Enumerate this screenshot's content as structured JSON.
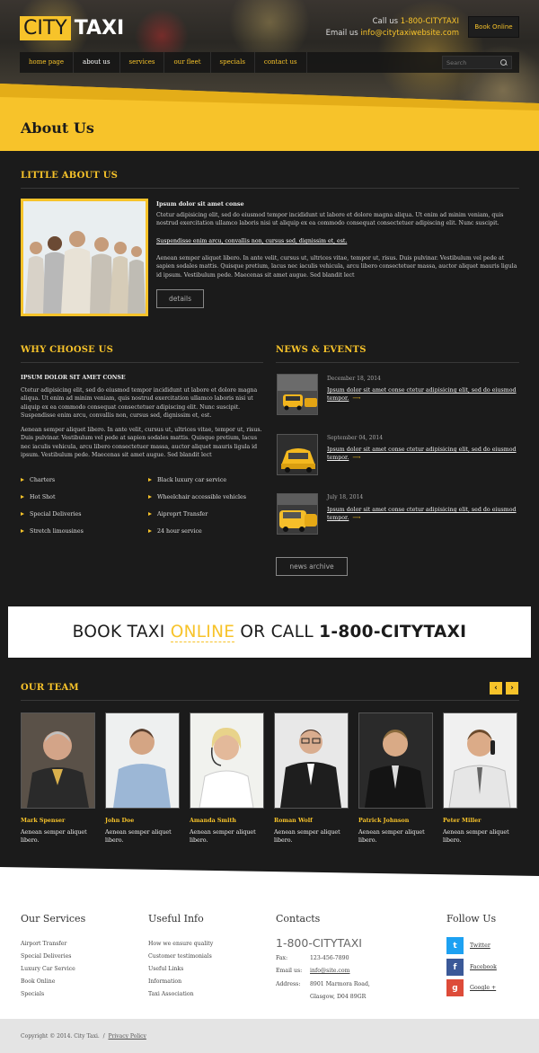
{
  "header": {
    "logo_city": "CITY",
    "logo_taxi": "TAXI",
    "call_label": "Call us",
    "phone": "1-800-CITYTAXI",
    "email_label": "Email us",
    "email": "info@citytaxiwebsite.com",
    "book_online": "Book Online",
    "nav": [
      {
        "label": "home page"
      },
      {
        "label": "about us"
      },
      {
        "label": "services"
      },
      {
        "label": "our fleet"
      },
      {
        "label": "specials"
      },
      {
        "label": "contact us"
      }
    ],
    "search_placeholder": "Search"
  },
  "page_title": "About Us",
  "little_about": {
    "title": "LITTLE ABOUT US",
    "subtitle": "Ipsum dolor sit amet conse",
    "para1": "Ctetur adipisicing elit, sed do eiusmod tempor incididunt ut labore et dolore magna aliqua. Ut enim ad minim veniam, quis nostrud exercitation ullamco laboris nisi ut aliquip ex ea commodo consequat consectetuer adipiscing elit. Nunc suscipit.",
    "link": "Suspendisse enim arcu, convallis non, cursus sed, dignissim et, est.",
    "para2": "Aenean semper aliquet libero. In ante velit, cursus ut, ultrices vitae, tempor ut, risus. Duis pulvinar. Vestibulum vel pede at sapien sodales mattis. Quisque pretium, lacus nec iaculis vehicula, arcu libero consectetuer massa, auctor aliquet mauris ligula id ipsum. Vestibulum pede. Maecenas sit amet augue. Sed blandit lect",
    "details": "details"
  },
  "why_choose": {
    "title": "WHY CHOOSE US",
    "subtitle": "IPSUM DOLOR SIT AMET CONSE",
    "para1": "Ctetur adipisicing elit, sed do eiusmod tempor incididunt ut labore et dolore magna aliqua. Ut enim ad minim veniam, quis nostrud exercitation ullamco laboris nisi ut aliquip ex ea commodo consequat consectetuer adipiscing elit. Nunc suscipit. Suspendisse enim arcu, convallis non, cursus sed, dignissim et, est.",
    "para2": "Aenean semper aliquet libero. In ante velit, cursus ut, ultrices vitae, tempor ut, risus. Duis pulvinar. Vestibulum vel pede at sapien sodales mattis. Quisque pretium, lacus nec iaculis vehicula, arcu libero consectetuer massa, auctor aliquet mauris ligula id ipsum. Vestibulum pede. Maecenas sit amet augue. Sed blandit lect",
    "list_left": [
      "Charters",
      "Hot Shot",
      "Special Deliveries",
      "Stretch limousines"
    ],
    "list_right": [
      "Black luxury car service",
      "Wheelchair accessible vehicles",
      "Aiproprt Transfer",
      "24 hour service"
    ]
  },
  "news": {
    "title": "NEWS & EVENTS",
    "items": [
      {
        "date": "December 18, 2014",
        "text": "Ipsum dolor sit amet conse ctetur adipisicing elit, sed do eiusmod tempor."
      },
      {
        "date": "September 04, 2014",
        "text": "Ipsum dolor sit amet conse ctetur adipisicing elit, sed do eiusmod tempor."
      },
      {
        "date": "July 18, 2014",
        "text": "Ipsum dolor sit amet conse ctetur adipisicing elit, sed do eiusmod tempor."
      }
    ],
    "archive": "news archive"
  },
  "banner": {
    "part1": "BOOK TAXI",
    "part2": "ONLINE",
    "part3": "OR CALL",
    "phone": "1-800-CITYTAXI"
  },
  "team": {
    "title": "OUR TEAM",
    "prev": "‹",
    "next": "›",
    "members": [
      {
        "name": "Mark Spenser",
        "desc": "Aenean semper aliquet libero."
      },
      {
        "name": "John Doe",
        "desc": "Aenean semper aliquet libero."
      },
      {
        "name": "Amanda Smith",
        "desc": "Aenean semper aliquet libero."
      },
      {
        "name": "Roman Wolf",
        "desc": "Aenean semper aliquet libero."
      },
      {
        "name": "Patrick Johnson",
        "desc": "Aenean semper aliquet libero."
      },
      {
        "name": "Peter Miller",
        "desc": "Aenean semper aliquet libero."
      }
    ]
  },
  "footer": {
    "services_title": "Our Services",
    "services": [
      "Airport Transfer",
      "Special Deliveries",
      "Luxury Car Service",
      "Book Online",
      "Specials"
    ],
    "info_title": "Useful Info",
    "info": [
      "How we ensure quality",
      "Customer testimonials",
      "Useful Links",
      "Information",
      "Taxi Association"
    ],
    "contacts_title": "Contacts",
    "phone": "1-800-CITYTAXI",
    "fax_label": "Fax:",
    "fax": "123-456-7890",
    "email_label": "Email us:",
    "email": "info@site.com",
    "address_label": "Address:",
    "address1": "8901 Marmora Road,",
    "address2": "Glasgow, D04 89GR",
    "follow_title": "Follow Us",
    "social": [
      {
        "icon": "t",
        "label": "Twitter",
        "color": "#1da1f2"
      },
      {
        "icon": "f",
        "label": "Facebook",
        "color": "#3b5998"
      },
      {
        "icon": "g",
        "label": "Google +",
        "color": "#dd4b39"
      }
    ],
    "copyright": "Copyright © 2014. City Taxi.",
    "separator": "/",
    "privacy": "Privacy Policy"
  }
}
